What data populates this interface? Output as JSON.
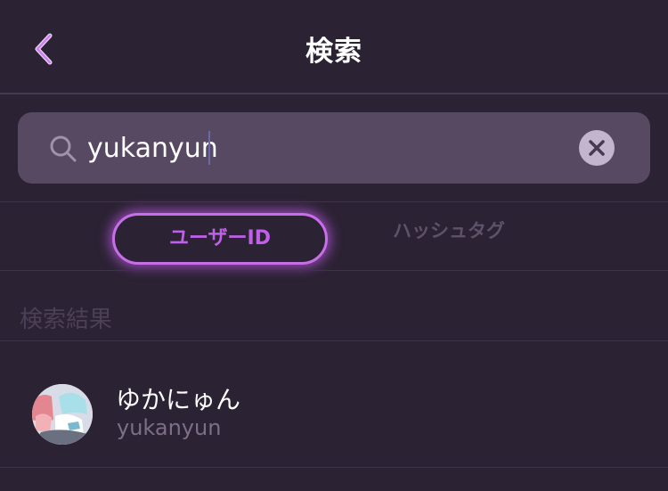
{
  "header": {
    "title": "検索",
    "back_icon": "chevron-left-icon",
    "back_color": "#c96ef0"
  },
  "search": {
    "value": "yukanyun",
    "placeholder": "",
    "search_icon": "search-icon",
    "clear_icon": "clear-icon"
  },
  "tabs": [
    {
      "label": "ユーザーID",
      "active": true
    },
    {
      "label": "ハッシュタグ",
      "active": false
    }
  ],
  "results": {
    "section_label": "検索結果",
    "items": [
      {
        "name": "ゆかにゅん",
        "id": "yukanyun",
        "avatar_icon": "avatar"
      }
    ]
  },
  "colors": {
    "background": "#2b2233",
    "search_field": "#584962",
    "accent": "#c060e8",
    "divider": "#3e3347"
  }
}
